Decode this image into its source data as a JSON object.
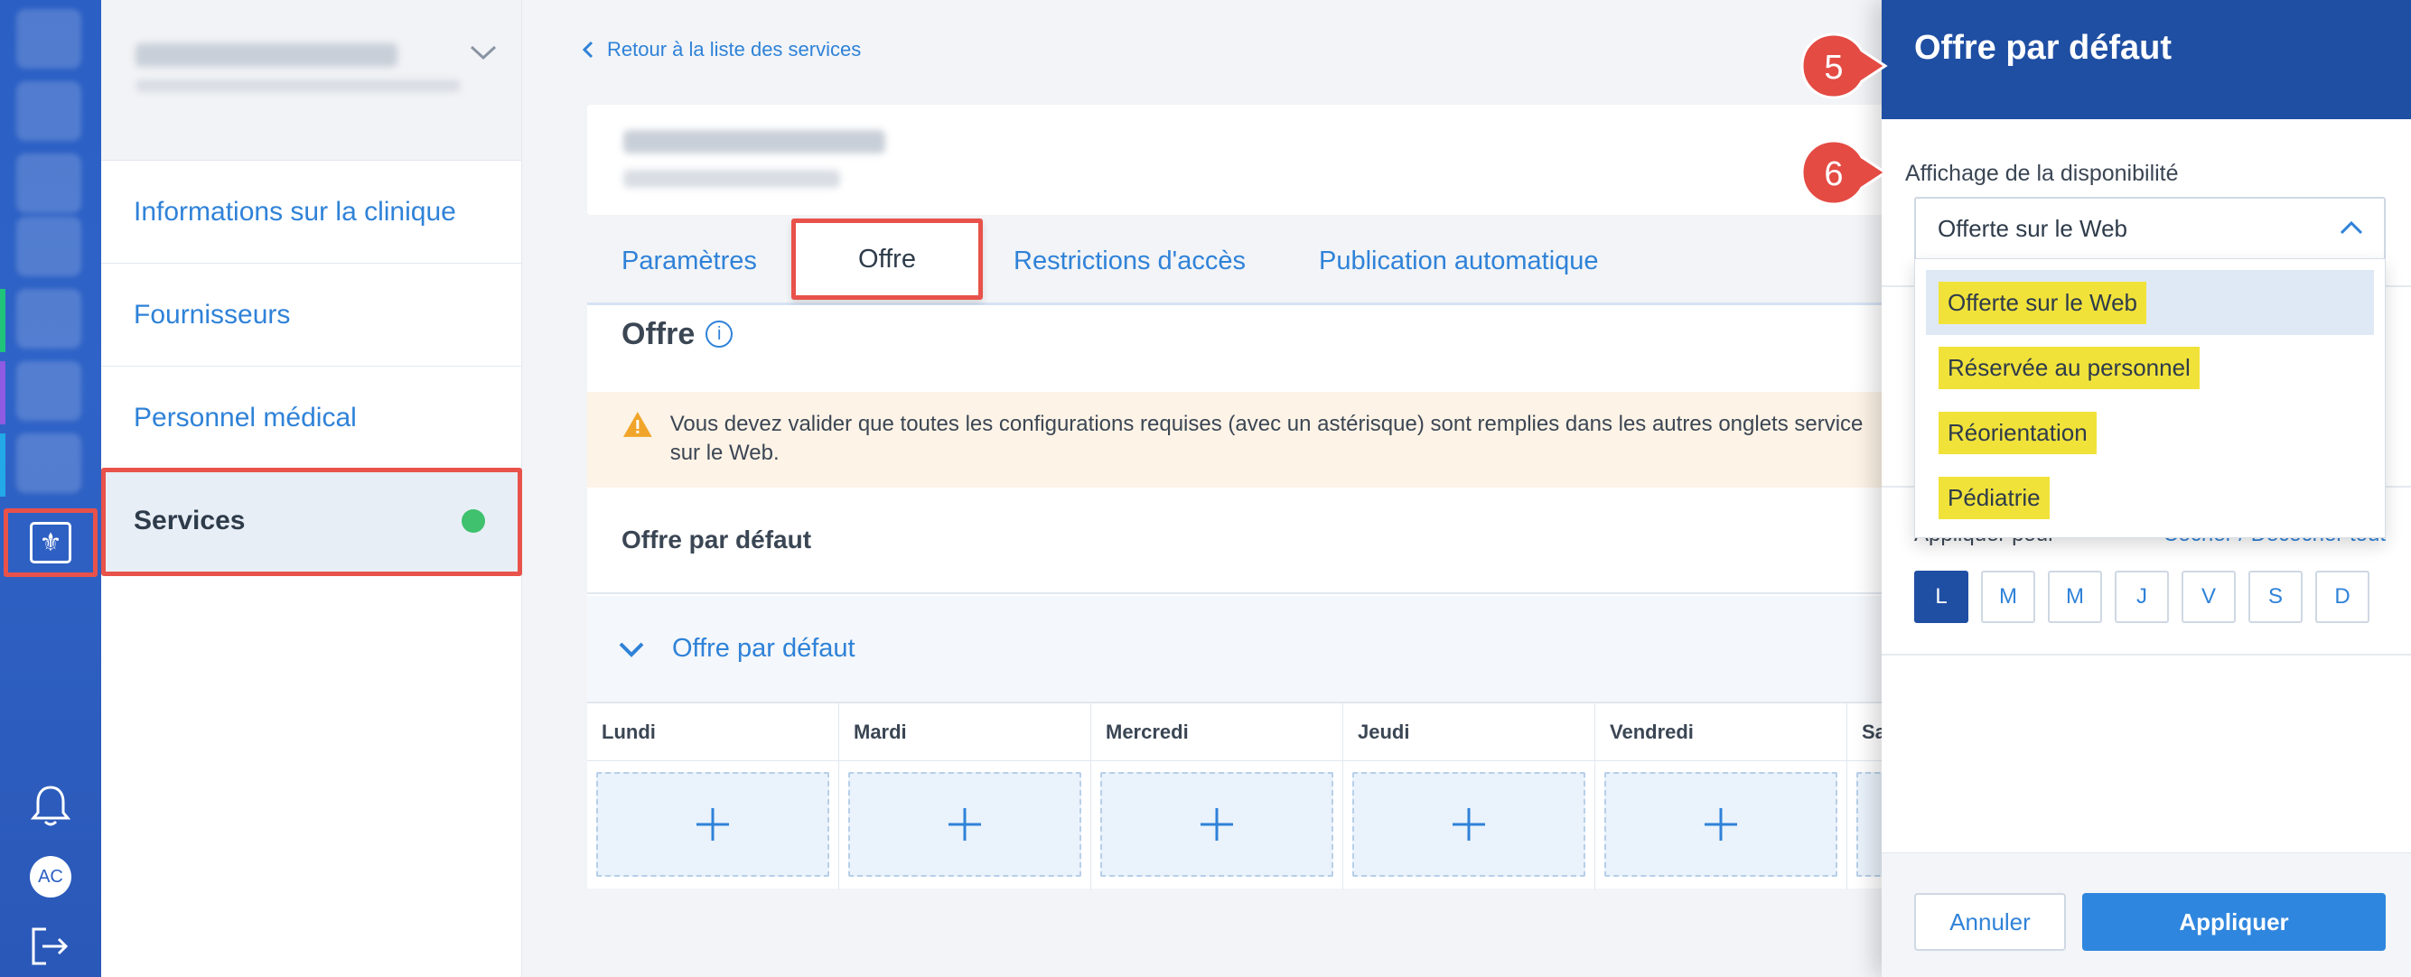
{
  "sidebar": {
    "items": [
      {
        "label": "Informations sur la clinique"
      },
      {
        "label": "Fournisseurs"
      },
      {
        "label": "Personnel médical"
      },
      {
        "label": "Services"
      }
    ]
  },
  "rail": {
    "avatar_initials": "AC"
  },
  "main": {
    "back_link": "Retour à la liste des services",
    "tabs": [
      {
        "label": "Paramètres"
      },
      {
        "label": "Offre"
      },
      {
        "label": "Restrictions d'accès"
      },
      {
        "label": "Publication automatique"
      }
    ],
    "section_title": "Offre",
    "warning_text": "Vous devez valider que toutes les configurations requises (avec un astérisque) sont remplies dans les autres onglets service sur le Web.",
    "default_offer_title": "Offre par défaut",
    "accordion_title": "Offre par défaut",
    "days": [
      "Lundi",
      "Mardi",
      "Mercredi",
      "Jeudi",
      "Vendredi",
      "Sa"
    ]
  },
  "drawer": {
    "title": "Offre par défaut",
    "field_label": "Affichage de la disponibilité",
    "selected_value": "Offerte sur le Web",
    "options": [
      "Offerte sur le Web",
      "Réservée au personnel",
      "Réorientation",
      "Pédiatrie"
    ],
    "apply_label_partial": "Appliquer pour",
    "toggle_all_partial": "Cocher / Décocher tout",
    "weekday_buttons": [
      "L",
      "M",
      "M",
      "J",
      "V",
      "S",
      "D"
    ],
    "cancel_label": "Annuler",
    "apply_label": "Appliquer"
  },
  "callouts": [
    "5",
    "6"
  ],
  "colors": {
    "primary": "#2f82d8",
    "drawer_header": "#1f4fa3",
    "highlight": "#e8524a",
    "option_highlight": "#f1e23a",
    "status_ok": "#3fc16e"
  }
}
